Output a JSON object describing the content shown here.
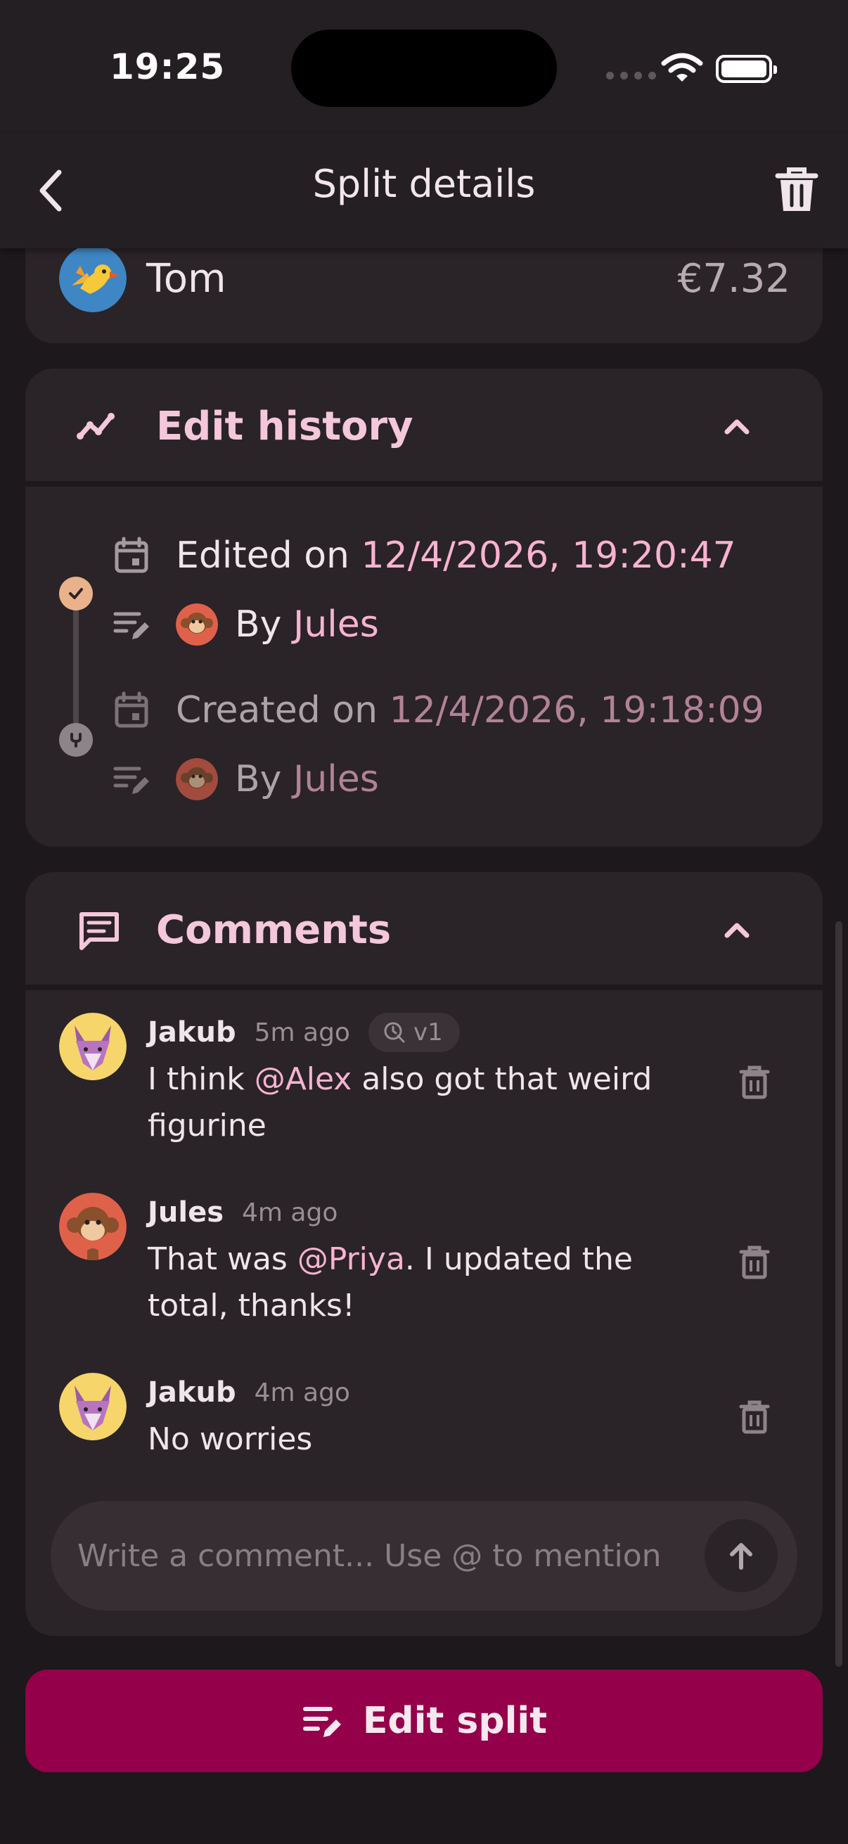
{
  "status_bar": {
    "time": "19:25"
  },
  "header": {
    "title": "Split details"
  },
  "payer": {
    "name": "Tom",
    "amount": "€7.32"
  },
  "edit_history": {
    "title": "Edit history",
    "entries": [
      {
        "prefix": "Edited on ",
        "datetime": "12/4/2026, 19:20:47",
        "by_label": "By ",
        "user": "Jules"
      },
      {
        "prefix": "Created on ",
        "datetime": "12/4/2026, 19:18:09",
        "by_label": "By ",
        "user": "Jules"
      }
    ]
  },
  "comments": {
    "title": "Comments",
    "items": [
      {
        "author": "Jakub",
        "time": "5m ago",
        "badge": "v1",
        "text_before": "I think ",
        "mention": "@Alex",
        "text_after": " also got that weird figurine"
      },
      {
        "author": "Jules",
        "time": "4m ago",
        "text_before": "That was ",
        "mention": "@Priya",
        "text_after": ". I updated the total, thanks!"
      },
      {
        "author": "Jakub",
        "time": "4m ago",
        "text": "No worries"
      }
    ],
    "input_placeholder": "Write a comment... Use @ to mention"
  },
  "actions": {
    "edit_split_label": "Edit split"
  },
  "colors": {
    "accent_pink": "#f7b3d0",
    "primary_button": "#94004a",
    "background": "#1d181b",
    "card": "#2a2327"
  },
  "icons": [
    "back-chevron-icon",
    "trash-icon",
    "trend-icon",
    "chevron-up-icon",
    "calendar-icon",
    "edit-list-icon",
    "chat-icon",
    "check-icon",
    "fork-icon",
    "send-arrow-icon"
  ]
}
